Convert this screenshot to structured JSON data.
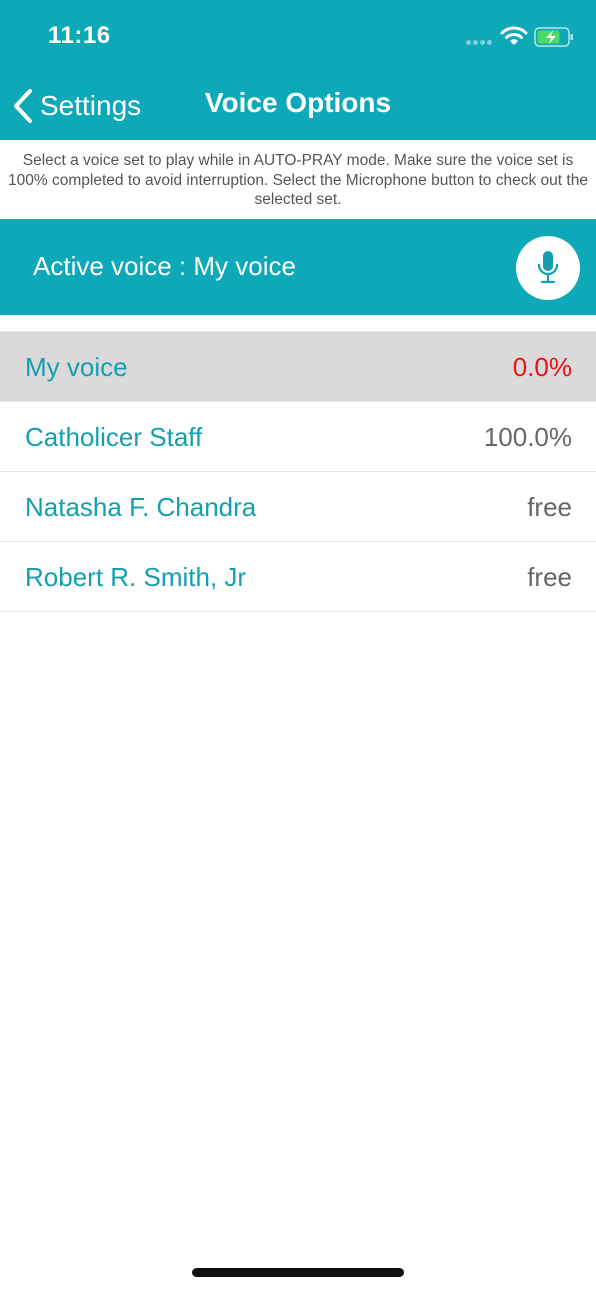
{
  "status_bar": {
    "time": "11:16"
  },
  "nav": {
    "back_label": "Settings",
    "title": "Voice Options"
  },
  "instructions": "Select a voice set to play while in AUTO-PRAY mode. Make sure the voice set is 100% completed to avoid interruption. Select the Microphone button to check out the selected set.",
  "active_voice": {
    "label": "Active voice : My voice"
  },
  "voices": [
    {
      "name": "My voice",
      "status": "0.0%"
    },
    {
      "name": "Catholicer Staff",
      "status": "100.0%"
    },
    {
      "name": "Natasha F. Chandra",
      "status": "free"
    },
    {
      "name": "Robert R. Smith, Jr",
      "status": "free"
    }
  ],
  "colors": {
    "brand_teal": "#0ea9b8",
    "name_teal": "#139fb0",
    "selected_row_bg": "#dadada",
    "incomplete_red": "#ee1111",
    "battery_green": "#4cd964"
  },
  "icons": {
    "back": "chevron-left-icon",
    "mic": "microphone-icon",
    "wifi": "wifi-icon",
    "battery": "battery-charging-icon"
  }
}
